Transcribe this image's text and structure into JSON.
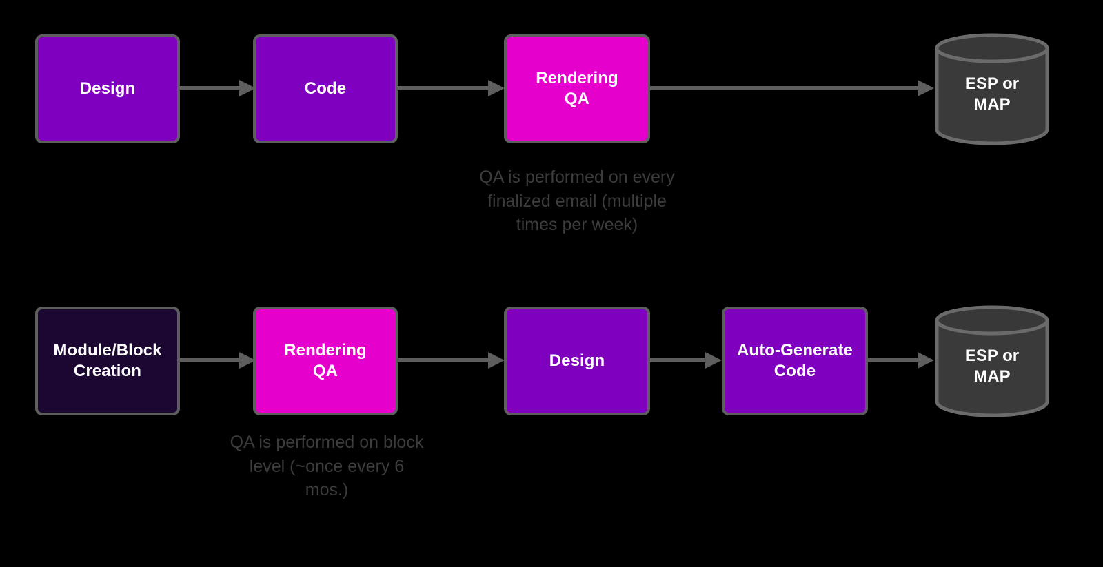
{
  "diagram": {
    "background_color": "#000000",
    "colors": {
      "purple": "#8000BF",
      "magenta": "#E600CC",
      "navy": "#1C0733",
      "cylinder": "#3A3A3A",
      "stroke": "#5E5E5E",
      "arrow": "#5E5E5E",
      "caption_text": "#3C3C3C",
      "node_text": "#FFFFFF"
    }
  },
  "rows": {
    "top": {
      "nodes": {
        "design": "Design",
        "code": "Code",
        "rendering_qa": "Rendering\nQA",
        "destination": "ESP or\nMAP"
      },
      "caption": "QA is performed on every finalized email (multiple times per week)"
    },
    "bottom": {
      "nodes": {
        "module_block_creation": "Module/Block\nCreation",
        "rendering_qa": "Rendering\nQA",
        "design": "Design",
        "auto_generate_code": "Auto-Generate\nCode",
        "destination": "ESP or\nMAP"
      },
      "caption": "QA is performed on block level (~once every 6 mos.)"
    }
  }
}
